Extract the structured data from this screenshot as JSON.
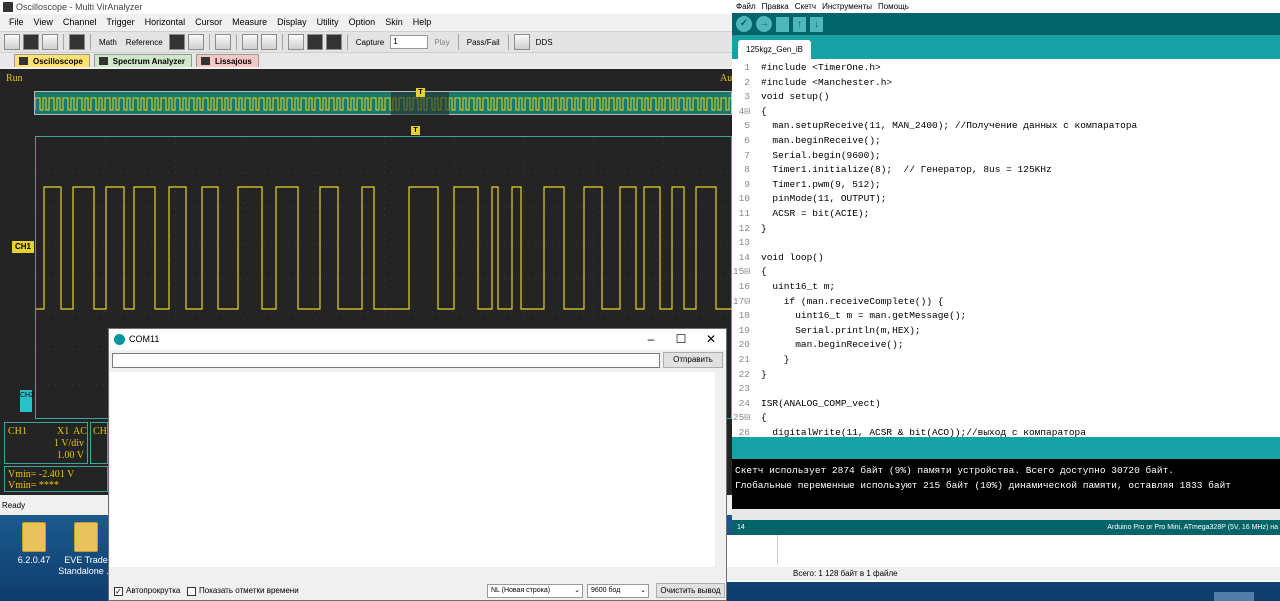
{
  "desktop": {
    "icons": [
      {
        "label": "6.2.0.47"
      },
      {
        "label": "EVE Trade Standalone ..."
      }
    ]
  },
  "oscilloscope": {
    "title": "Oscilloscope - Multi VirAnalyzer",
    "menu": [
      "File",
      "View",
      "Channel",
      "Trigger",
      "Horizontal",
      "Cursor",
      "Measure",
      "Display",
      "Utility",
      "Option",
      "Skin",
      "Help"
    ],
    "toolbar": {
      "math": "Math",
      "reference": "Reference",
      "capture": "Capture",
      "capture_value": "1",
      "play": "Play",
      "passfail": "Pass/Fail",
      "dds": "DDS"
    },
    "tabs": [
      "Oscilloscope",
      "Spectrum Analyzer",
      "Lissajous"
    ],
    "run_label": "Run",
    "auto_label": "Au",
    "trigger_marker": "T",
    "ch1_marker": "CH1",
    "ch2_marker": "CH2",
    "ch1_info": {
      "name": "CH1",
      "probe": "X1",
      "coupling": "AC",
      "vdiv": "1 V/div",
      "offset": "1.00 V"
    },
    "ch2_info": {
      "name": "CH"
    },
    "vmin1": "Vmin= -2.401 V",
    "vmin2": "Vmin= ****",
    "status": "Ready",
    "colors": {
      "trace": "#e6d22a",
      "grid": "#3aa89a",
      "background": "#242424"
    }
  },
  "arduino": {
    "menu": [
      "Файл",
      "Правка",
      "Скетч",
      "Инструменты",
      "Помощь"
    ],
    "tab": "125kgz_Gen_iB",
    "code": [
      {
        "n": "1",
        "text": "#include <TimerOne.h>"
      },
      {
        "n": "2",
        "text": "#include <Manchester.h>"
      },
      {
        "n": "3",
        "text": "void setup()"
      },
      {
        "n": "4⊟",
        "text": "{"
      },
      {
        "n": "5",
        "text": "  man.setupReceive(11, MAN_2400); //Получение данных с компаратора"
      },
      {
        "n": "6",
        "text": "  man.beginReceive();"
      },
      {
        "n": "7",
        "text": "  Serial.begin(9600);"
      },
      {
        "n": "8",
        "text": "  Timer1.initialize(8);  // Генератор, 8us = 125KHz"
      },
      {
        "n": "9",
        "text": "  Timer1.pwm(9, 512);"
      },
      {
        "n": "10",
        "text": "  pinMode(11, OUTPUT);"
      },
      {
        "n": "11",
        "text": "  ACSR = bit(ACIE);"
      },
      {
        "n": "12",
        "text": "}"
      },
      {
        "n": "13",
        "text": ""
      },
      {
        "n": "14",
        "text": "void loop()"
      },
      {
        "n": "15⊟",
        "text": "{"
      },
      {
        "n": "16",
        "text": "  uint16_t m;"
      },
      {
        "n": "17⊟",
        "text": "    if (man.receiveComplete()) {"
      },
      {
        "n": "18",
        "text": "      uint16_t m = man.getMessage();"
      },
      {
        "n": "19",
        "text": "      Serial.println(m,HEX);"
      },
      {
        "n": "20",
        "text": "      man.beginReceive();"
      },
      {
        "n": "21",
        "text": "    }"
      },
      {
        "n": "22",
        "text": "}"
      },
      {
        "n": "23",
        "text": ""
      },
      {
        "n": "24",
        "text": "ISR(ANALOG_COMP_vect)"
      },
      {
        "n": "25⊟",
        "text": "{"
      },
      {
        "n": "26",
        "text": "  digitalWrite(11, ACSR & bit(ACO));//выход с компаратора"
      }
    ],
    "console": [
      "Скетч использует 2874 байт (9%) памяти устройства. Всего доступно 30720 байт.",
      "Глобальные переменные используют 215 байт (10%) динамической памяти, оставляя 1833 байт"
    ],
    "status_line": "14",
    "board": "Arduino Pro or Pro Mini, ATmega328P (5V, 16 MHz) на"
  },
  "explorer": {
    "status": "Всего: 1 128 байт в 1 файле"
  },
  "serial": {
    "title": "COM11",
    "send_label": "Отправить",
    "input_value": "",
    "autoscroll_label": "Автопрокрутка",
    "autoscroll_checked": true,
    "timestamps_label": "Показать отметки времени",
    "line_ending": "NL (Новая строка)",
    "baud": "9600 бод",
    "clear_label": "Очистить вывод"
  }
}
